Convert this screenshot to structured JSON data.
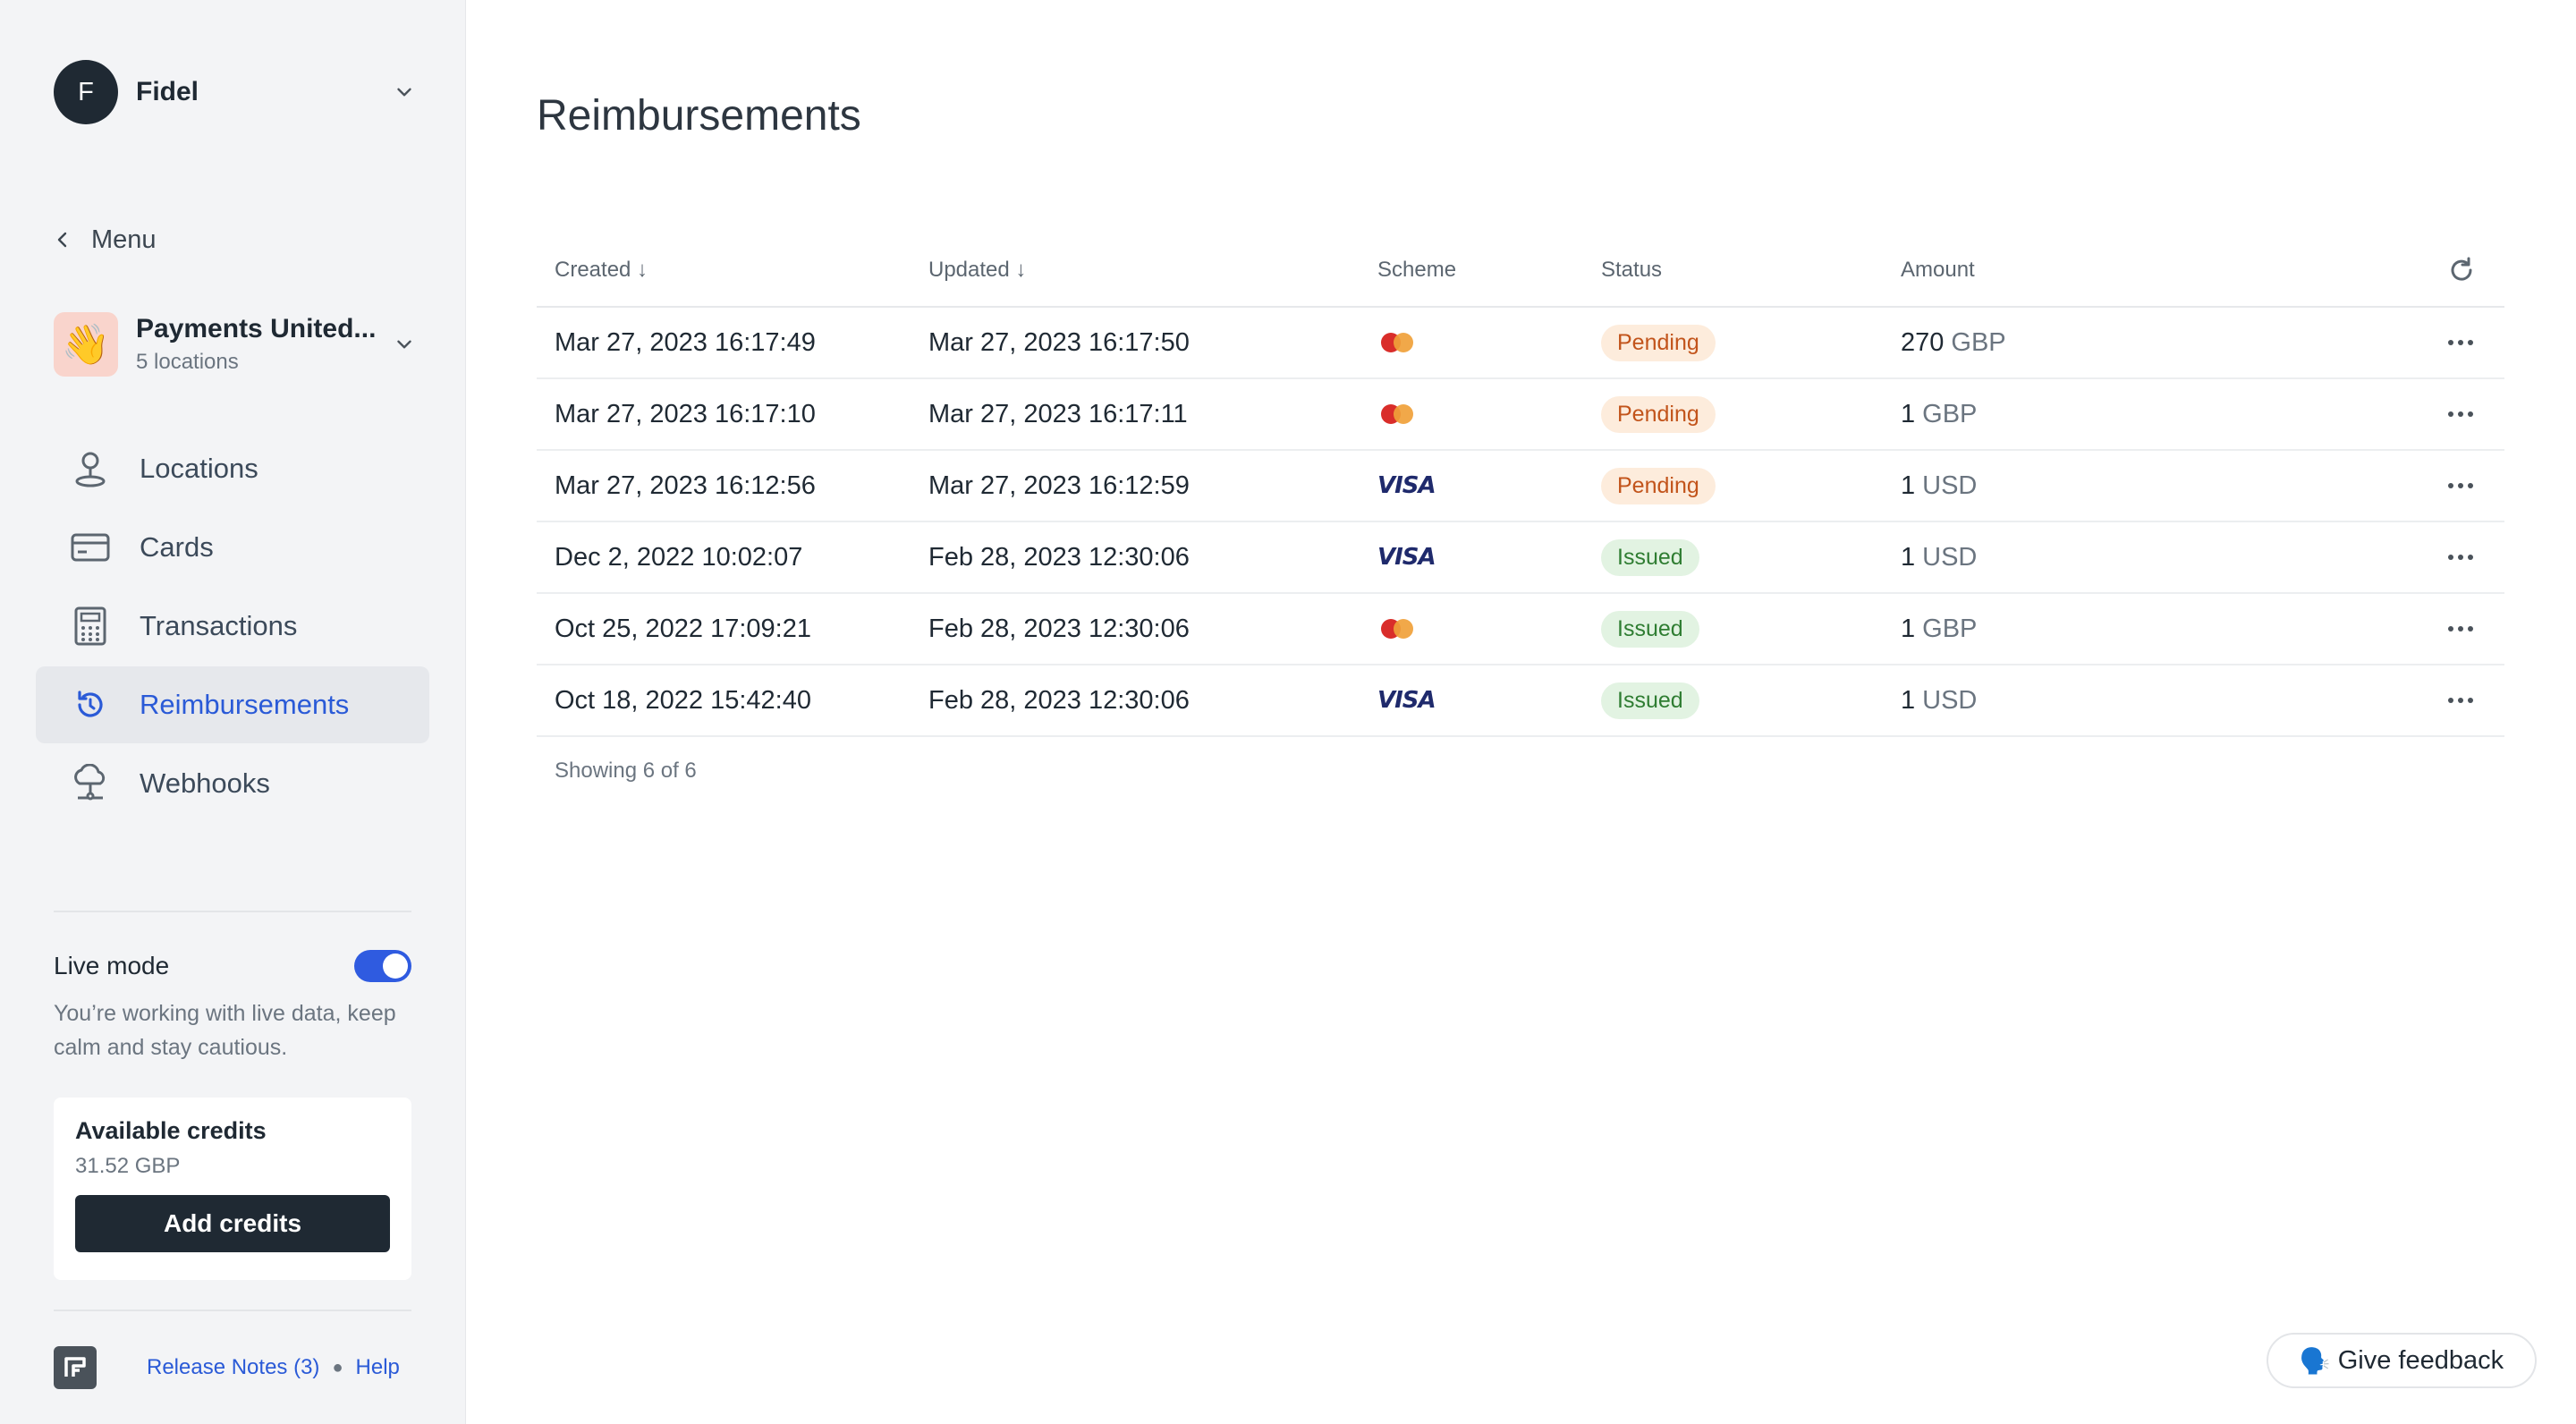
{
  "account": {
    "initial": "F",
    "name": "Fidel"
  },
  "menu_back": {
    "label": "Menu"
  },
  "org": {
    "logo": "👋",
    "name": "Payments United...",
    "sub": "5 locations"
  },
  "nav": [
    {
      "label": "Locations",
      "icon": "map-pin-icon"
    },
    {
      "label": "Cards",
      "icon": "card-icon"
    },
    {
      "label": "Transactions",
      "icon": "calculator-icon"
    },
    {
      "label": "Reimbursements",
      "icon": "refresh-icon",
      "active": true
    },
    {
      "label": "Webhooks",
      "icon": "webhook-icon"
    }
  ],
  "live_mode": {
    "title": "Live mode",
    "enabled": true,
    "description": "You’re working with live data, keep calm and stay cautious."
  },
  "credits": {
    "title": "Available credits",
    "value": "31.52 GBP",
    "button": "Add credits"
  },
  "footer": {
    "release_notes": "Release Notes",
    "release_count": "(3)",
    "help": "Help"
  },
  "page": {
    "title": "Reimbursements"
  },
  "table": {
    "headers": {
      "created": "Created ↓",
      "updated": "Updated ↓",
      "scheme": "Scheme",
      "status": "Status",
      "amount": "Amount"
    },
    "rows": [
      {
        "created": "Mar 27, 2023 16:17:49",
        "updated": "Mar 27, 2023 16:17:50",
        "scheme": "mastercard",
        "status": "Pending",
        "amount": "270",
        "currency": "GBP"
      },
      {
        "created": "Mar 27, 2023 16:17:10",
        "updated": "Mar 27, 2023 16:17:11",
        "scheme": "mastercard",
        "status": "Pending",
        "amount": "1",
        "currency": "GBP"
      },
      {
        "created": "Mar 27, 2023 16:12:56",
        "updated": "Mar 27, 2023 16:12:59",
        "scheme": "VISA",
        "status": "Pending",
        "amount": "1",
        "currency": "USD"
      },
      {
        "created": "Dec 2, 2022 10:02:07",
        "updated": "Feb 28, 2023 12:30:06",
        "scheme": "VISA",
        "status": "Issued",
        "amount": "1",
        "currency": "USD"
      },
      {
        "created": "Oct 25, 2022 17:09:21",
        "updated": "Feb 28, 2023 12:30:06",
        "scheme": "mastercard",
        "status": "Issued",
        "amount": "1",
        "currency": "GBP"
      },
      {
        "created": "Oct 18, 2022 15:42:40",
        "updated": "Feb 28, 2023 12:30:06",
        "scheme": "VISA",
        "status": "Issued",
        "amount": "1",
        "currency": "USD"
      }
    ],
    "showing": "Showing 6 of 6"
  },
  "feedback": {
    "emoji": "🗣️",
    "label": "Give feedback"
  },
  "colors": {
    "accent": "#2a5ad7",
    "pending_bg": "#fdecdc",
    "pending_fg": "#c2541b",
    "issued_bg": "#e2f3e2",
    "issued_fg": "#2f7d32",
    "dark": "#1f2933"
  }
}
